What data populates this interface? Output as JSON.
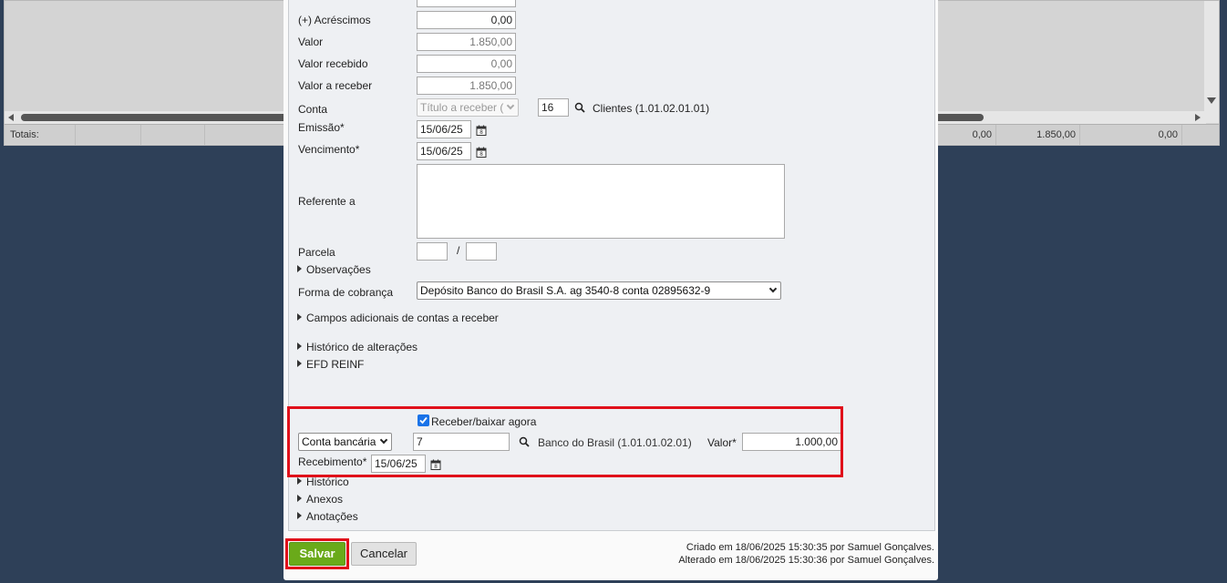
{
  "background": {
    "totals_label": "Totais:",
    "totals_values": [
      "0,00",
      "1.850,00",
      "0,00"
    ]
  },
  "form": {
    "acrescimos": {
      "label": "(+) Acréscimos",
      "value": "0,00"
    },
    "valor": {
      "label": "Valor",
      "value": "1.850,00"
    },
    "valor_recebido": {
      "label": "Valor recebido",
      "value": "0,00"
    },
    "valor_a_receber": {
      "label": "Valor a receber",
      "value": "1.850,00"
    },
    "conta": {
      "label": "Conta",
      "type_select": "Título a receber (",
      "code": "16",
      "description": "Clientes (1.01.02.01.01)"
    },
    "emissao": {
      "label": "Emissão*",
      "value": "15/06/25"
    },
    "vencimento": {
      "label": "Vencimento*",
      "value": "15/06/25"
    },
    "referente_a": {
      "label": "Referente a",
      "value": ""
    },
    "parcela": {
      "label": "Parcela",
      "separator": "/",
      "value1": "",
      "value2": ""
    },
    "observacoes": "Observações",
    "forma_cobranca": {
      "label": "Forma de cobrança",
      "value": "Depósito Banco do Brasil S.A. ag 3540-8 conta 02895632-9"
    },
    "campos_adicionais": "Campos adicionais de contas a receber",
    "historico_alteracoes": "Histórico de alterações",
    "efd_reinf": "EFD REINF"
  },
  "receber": {
    "checkbox_label": "Receber/baixar agora",
    "checked": true,
    "account_type": "Conta bancária",
    "account_code": "7",
    "account_description": "Banco do Brasil (1.01.01.02.01)",
    "valor_label": "Valor*",
    "valor": "1.000,00",
    "recebimento_label": "Recebimento*",
    "recebimento": "15/06/25"
  },
  "sections": {
    "historico": "Histórico",
    "anexos": "Anexos",
    "anotacoes": "Anotações"
  },
  "footer": {
    "save": "Salvar",
    "cancel": "Cancelar",
    "created": "Criado em 18/06/2025 15:30:35 por Samuel Gonçalves.",
    "modified": "Alterado em 18/06/2025 15:30:36 por Samuel Gonçalves."
  },
  "colors": {
    "highlight": "#e0101a",
    "save_button": "#6aaa1a",
    "backdrop": "#2e4058"
  }
}
